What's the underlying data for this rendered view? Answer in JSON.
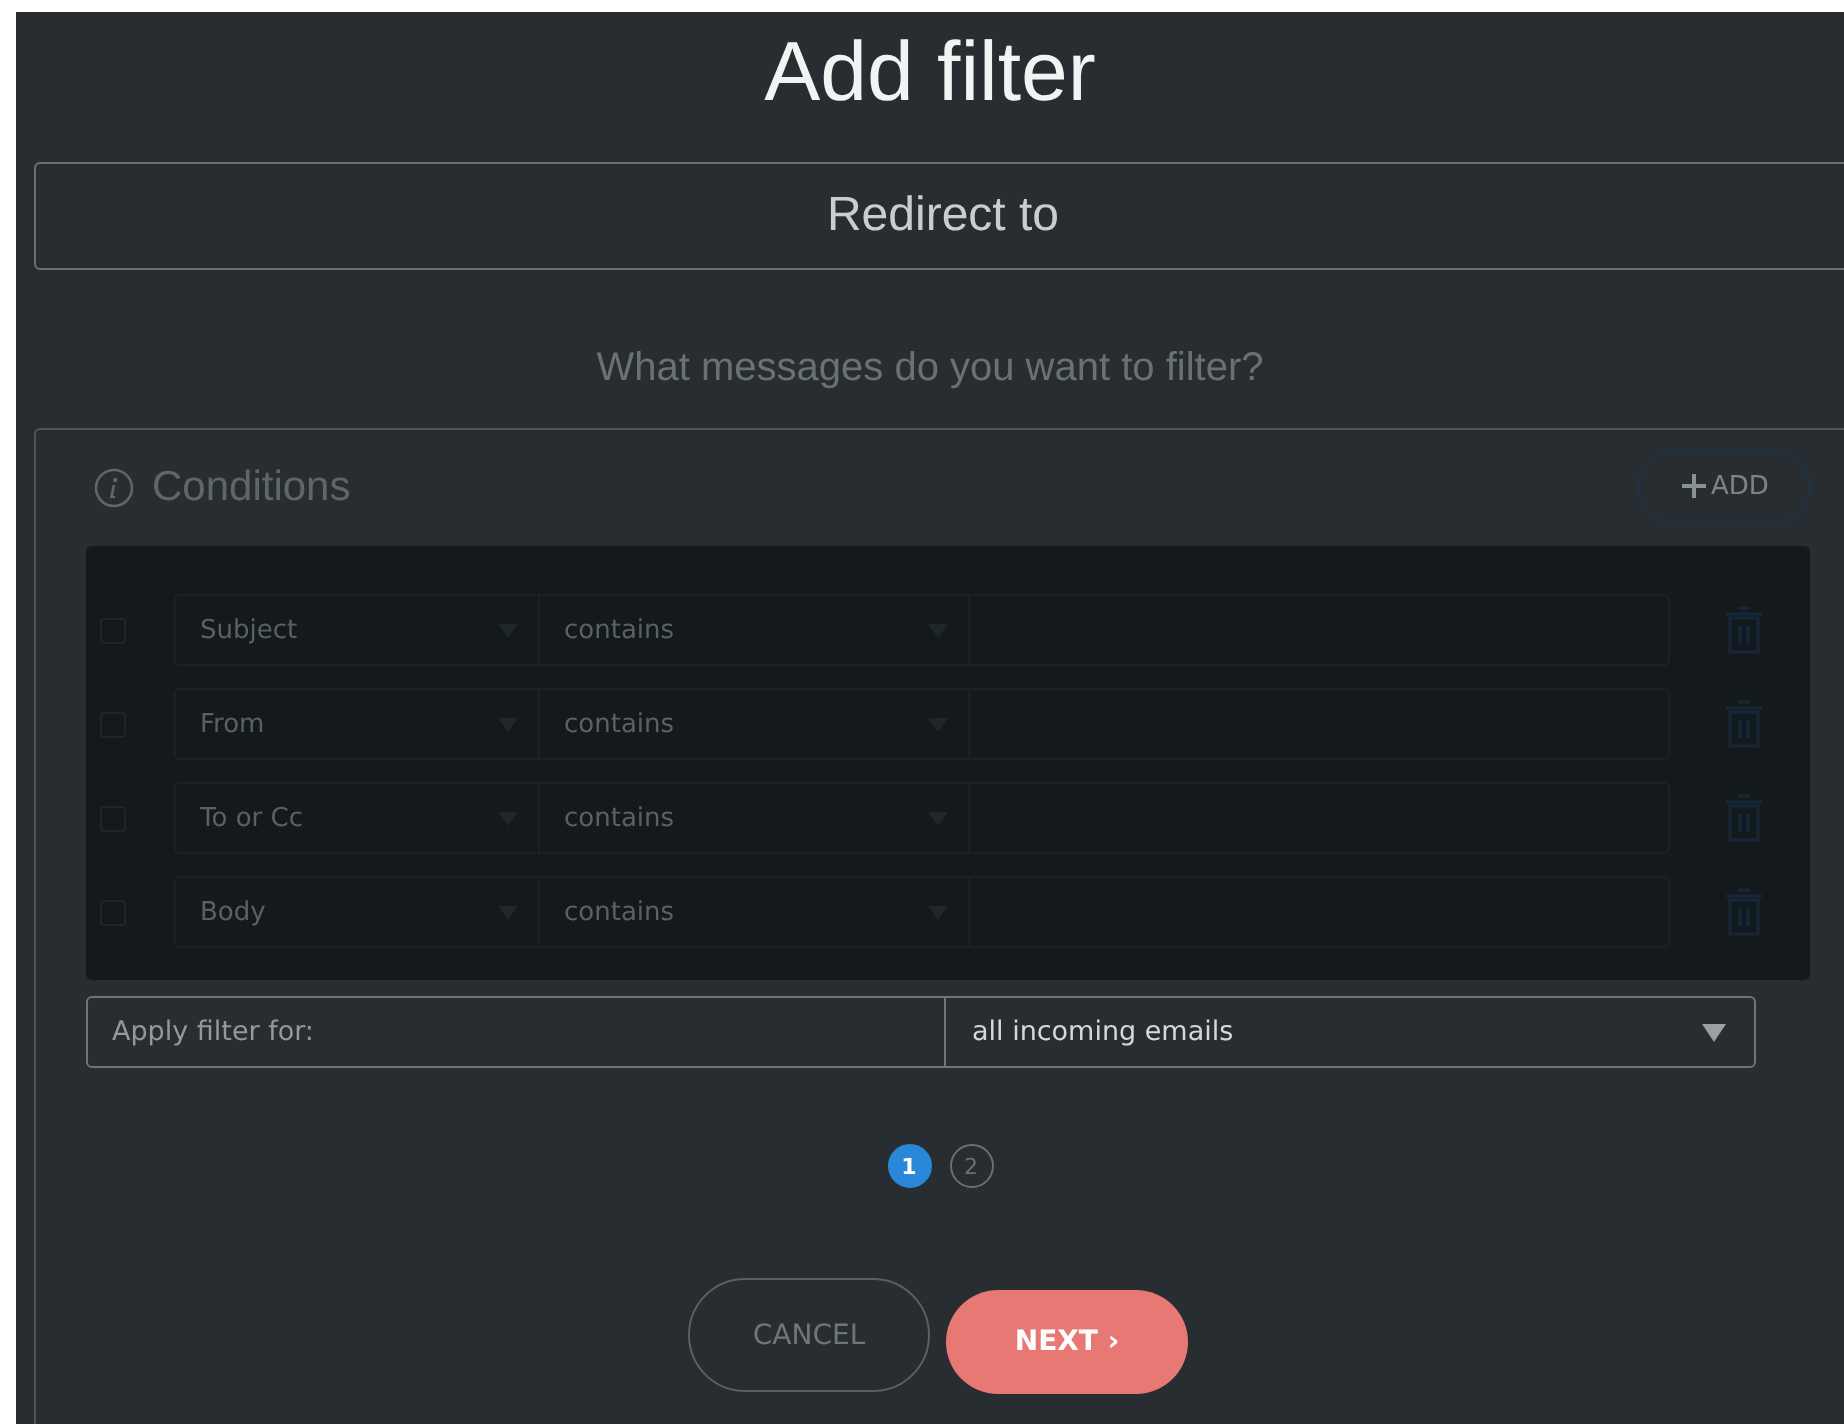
{
  "dialog": {
    "title": "Add filter",
    "action": "Redirect to",
    "question": "What messages do you want to filter?"
  },
  "conditions": {
    "title": "Conditions",
    "add_button": "ADD",
    "rows": [
      {
        "checked": false,
        "field": "Subject",
        "operator": "contains"
      },
      {
        "checked": false,
        "field": "From",
        "operator": "contains"
      },
      {
        "checked": false,
        "field": "To or Cc",
        "operator": "contains"
      },
      {
        "checked": false,
        "field": "Body",
        "operator": "contains"
      }
    ]
  },
  "apply": {
    "label": "Apply filter for:",
    "value": "all incoming emails"
  },
  "steps": [
    {
      "label": "1",
      "selected": true
    },
    {
      "label": "2",
      "selected": false
    }
  ],
  "buttons": {
    "cancel": "CANCEL",
    "next": "NEXT ›"
  }
}
